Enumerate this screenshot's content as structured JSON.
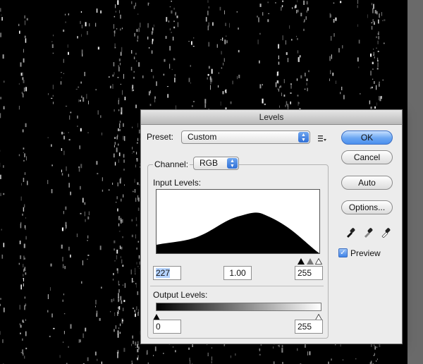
{
  "dialog": {
    "title": "Levels",
    "preset_label": "Preset:",
    "preset_value": "Custom",
    "channel_label": "Channel:",
    "channel_value": "RGB",
    "input_levels_label": "Input Levels:",
    "input_black": "227",
    "input_gamma": "1.00",
    "input_white": "255",
    "output_levels_label": "Output Levels:",
    "output_black": "0",
    "output_white": "255"
  },
  "buttons": {
    "ok": "OK",
    "cancel": "Cancel",
    "auto": "Auto",
    "options": "Options..."
  },
  "preview": {
    "label": "Preview",
    "checked": true
  },
  "icons": {
    "preset_menu": "preset-menu-icon",
    "eyedroppers": [
      "black-point-eyedropper-icon",
      "gray-point-eyedropper-icon",
      "white-point-eyedropper-icon"
    ]
  },
  "colors": {
    "accent": "#4d90ee",
    "background": "#000000",
    "dialog": "#ececec"
  }
}
